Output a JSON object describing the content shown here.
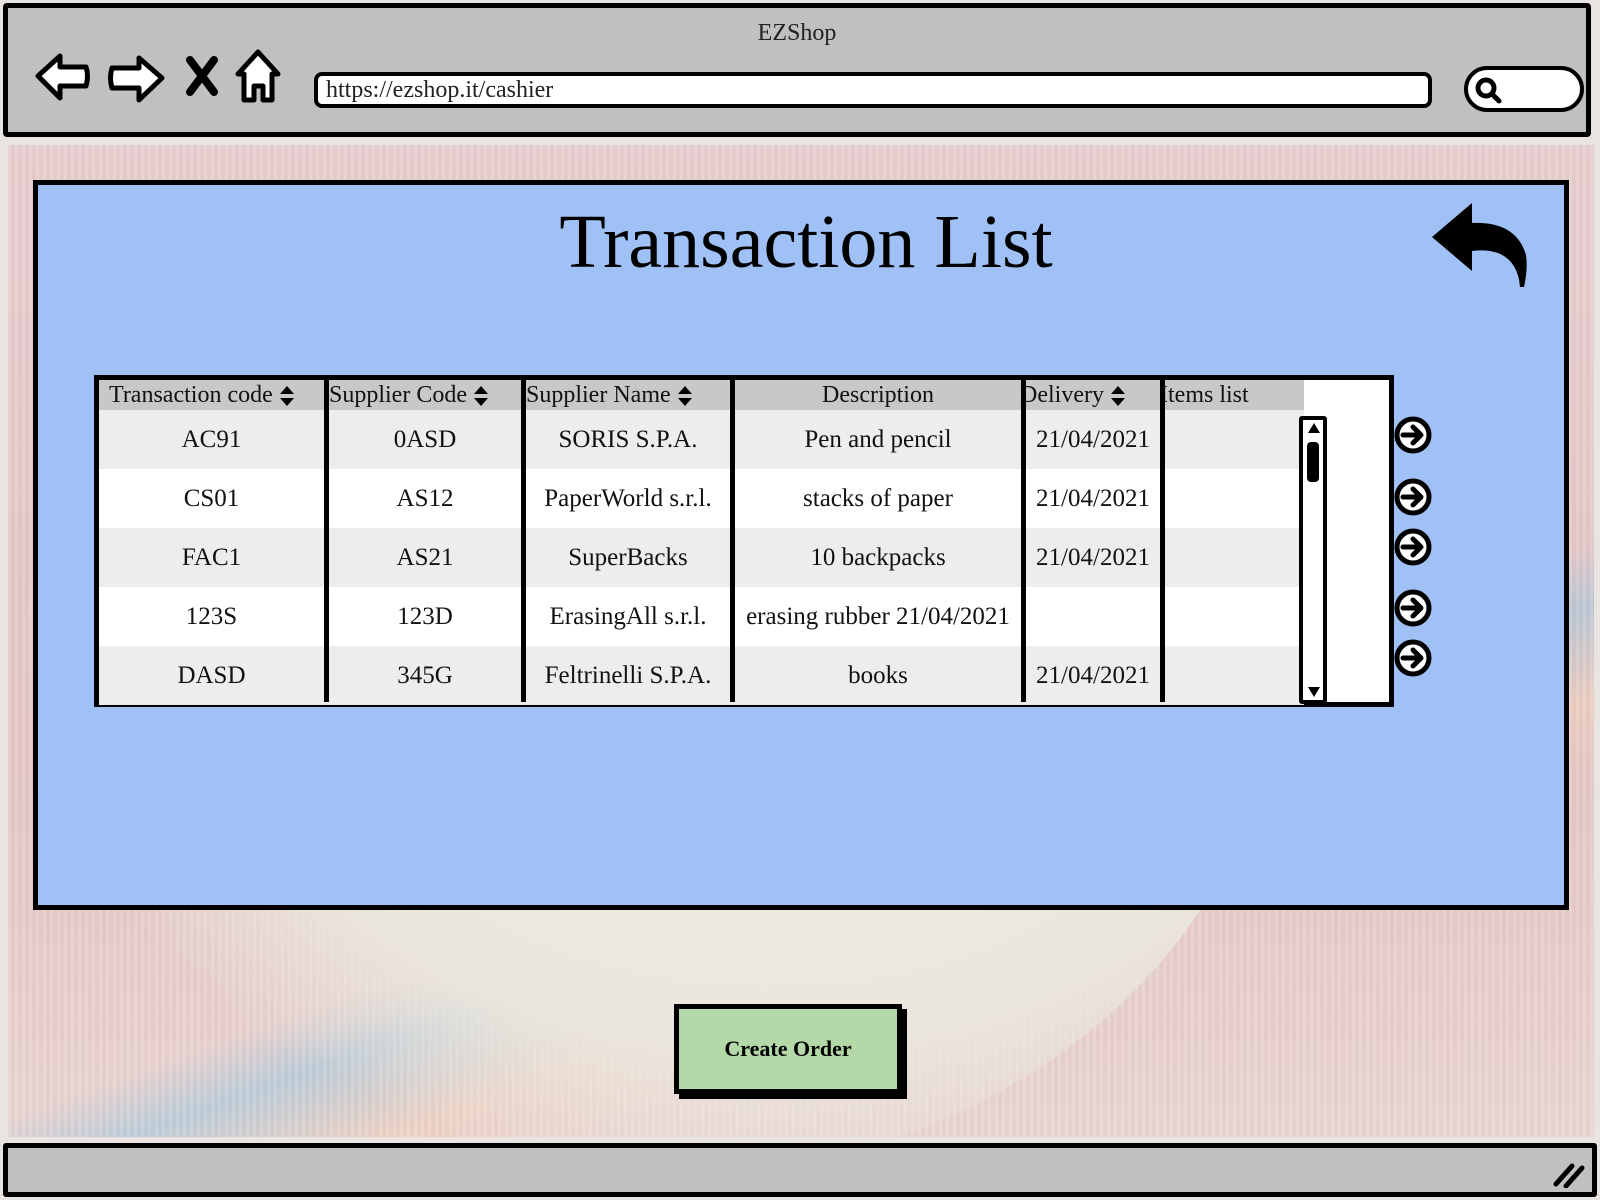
{
  "browser": {
    "title": "EZShop",
    "url": "https://ezshop.it/cashier",
    "nav_icons": [
      "back-arrow-icon",
      "forward-arrow-icon",
      "close-x-icon",
      "home-icon"
    ],
    "search_icon": "search-icon"
  },
  "page": {
    "title": "Transaction List",
    "back_icon": "undo-arrow-icon"
  },
  "table": {
    "columns": [
      {
        "label": "Transaction code",
        "sortable": true
      },
      {
        "label": "Supplier Code",
        "sortable": true
      },
      {
        "label": "Supplier Name",
        "sortable": true
      },
      {
        "label": "Description",
        "sortable": false
      },
      {
        "label": "Delivery",
        "sortable": true
      },
      {
        "label": "Items list",
        "sortable": false
      }
    ],
    "rows": [
      {
        "transaction_code": "AC91",
        "supplier_code": "0ASD",
        "supplier_name": "SORIS S.P.A.",
        "description": "Pen and pencil",
        "delivery": "21/04/2021",
        "items_list": ""
      },
      {
        "transaction_code": "CS01",
        "supplier_code": "AS12",
        "supplier_name": "PaperWorld s.r.l.",
        "description": "stacks of paper",
        "delivery": "21/04/2021",
        "items_list": ""
      },
      {
        "transaction_code": "FAC1",
        "supplier_code": "AS21",
        "supplier_name": "SuperBacks",
        "description": "10 backpacks",
        "delivery": "21/04/2021",
        "items_list": ""
      },
      {
        "transaction_code": "123S",
        "supplier_code": "123D",
        "supplier_name": "ErasingAll s.r.l.",
        "description": "erasing rubber 21/04/2021",
        "delivery": "",
        "items_list": ""
      },
      {
        "transaction_code": "DASD",
        "supplier_code": "345G",
        "supplier_name": "Feltrinelli S.P.A.",
        "description": "books",
        "delivery": "21/04/2021",
        "items_list": ""
      }
    ],
    "row_action_icon": "arrow-right-circle-icon"
  },
  "actions": {
    "create_order_label": "Create Order"
  },
  "colors": {
    "panel": "#9fc1f6",
    "header": "#c8c8c8",
    "alt_row": "#ededed",
    "create_button": "#b4d8a8",
    "chrome": "#c0c0c0"
  }
}
